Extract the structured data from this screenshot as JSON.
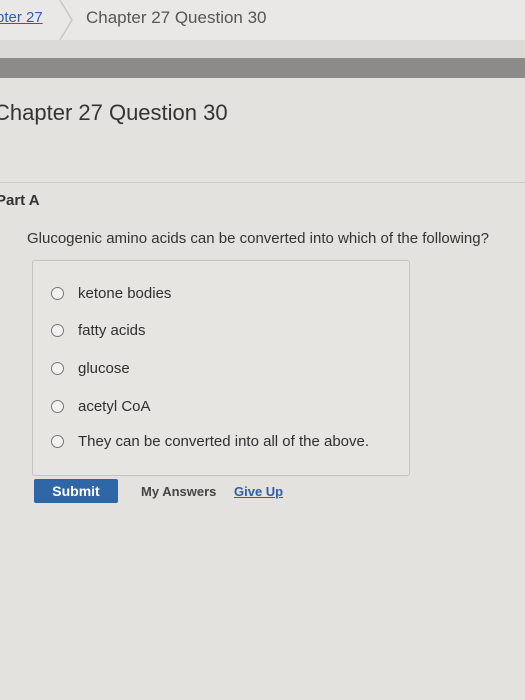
{
  "breadcrumb": {
    "link": "pter 27",
    "current": "Chapter 27 Question 30"
  },
  "page_title": "Chapter 27 Question 30",
  "part_title": "Part A",
  "question": "Glucogenic amino acids can be converted into which of the following?",
  "options": [
    "ketone bodies",
    "fatty acids",
    "glucose",
    "acetyl CoA",
    "They can be converted into all of the above."
  ],
  "actions": {
    "submit": "Submit",
    "my_answers": "My Answers",
    "give_up": "Give Up"
  },
  "colors": {
    "accent": "#2f67a6",
    "link": "#2f5fa6"
  }
}
